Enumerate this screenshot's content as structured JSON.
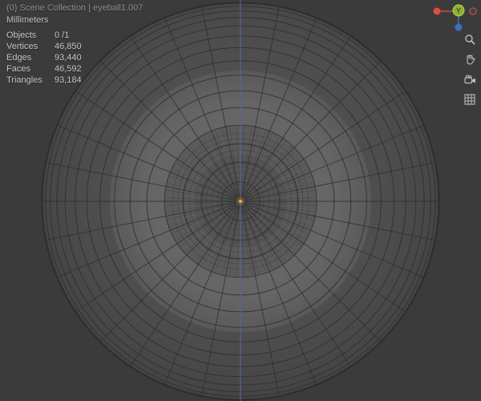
{
  "header": {
    "breadcrumb": "(0) Scene Collection | eyeball1.007",
    "units": "Millimeters"
  },
  "stats": {
    "rows": [
      {
        "label": "Objects",
        "value": "0 /1"
      },
      {
        "label": "Vertices",
        "value": "46,850"
      },
      {
        "label": "Edges",
        "value": "93,440"
      },
      {
        "label": "Faces",
        "value": "46,592"
      },
      {
        "label": "Triangles",
        "value": "93,184"
      }
    ]
  },
  "gizmo": {
    "y_label": "Y",
    "colors": {
      "x": "#e14b44",
      "y": "#8fae36",
      "z": "#3f6fc4"
    }
  },
  "scene": {
    "object_origin_color": "#ffa02e",
    "axis_line_color": "#5878ab",
    "wire_color": "#2e2e2e",
    "background": "#3b3b3b"
  },
  "toolbar": {
    "icons": [
      {
        "name": "zoom"
      },
      {
        "name": "hand"
      },
      {
        "name": "camera"
      },
      {
        "name": "grid"
      }
    ]
  }
}
